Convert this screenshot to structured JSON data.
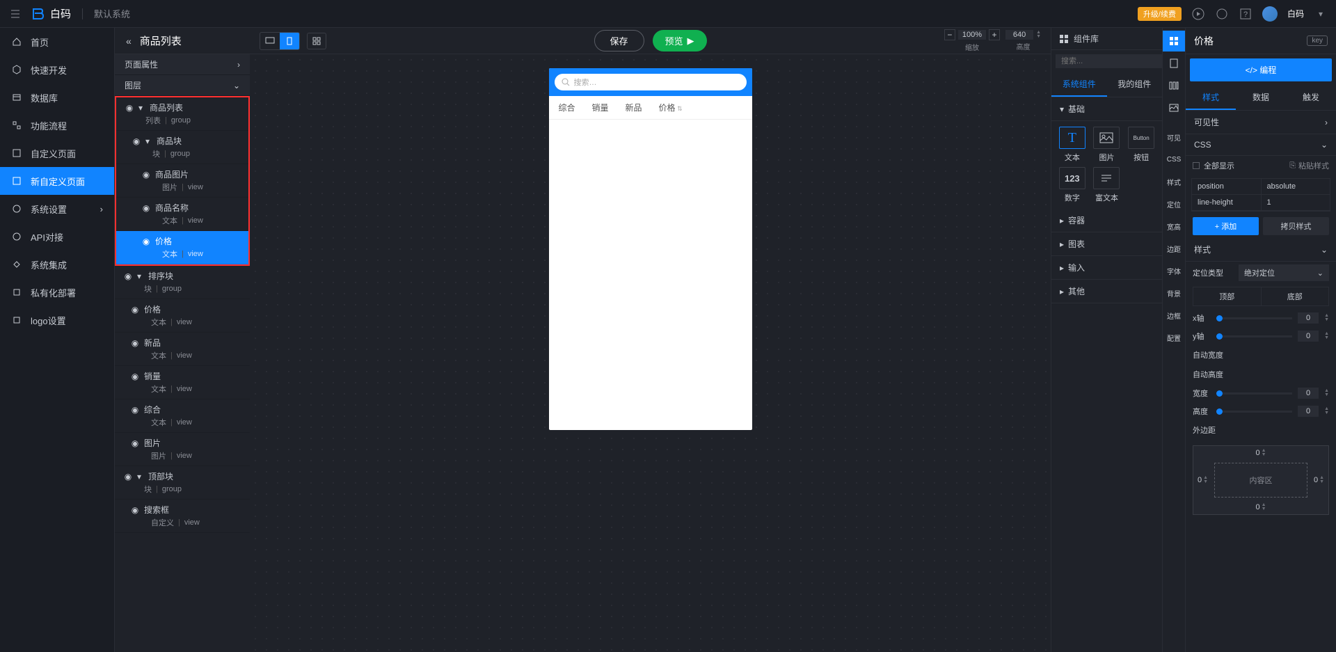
{
  "header": {
    "logo_text": "白码",
    "system_name": "默认系统",
    "upgrade": "升级/续费",
    "username": "白码"
  },
  "nav": {
    "items": [
      {
        "label": "首页"
      },
      {
        "label": "快速开发"
      },
      {
        "label": "数据库"
      },
      {
        "label": "功能流程"
      },
      {
        "label": "自定义页面"
      },
      {
        "label": "新自定义页面"
      },
      {
        "label": "系统设置"
      },
      {
        "label": "API对接"
      },
      {
        "label": "系统集成"
      },
      {
        "label": "私有化部署"
      },
      {
        "label": "logo设置"
      }
    ]
  },
  "layers": {
    "title": "商品列表",
    "panel_props": "页面属性",
    "panel_layers": "图层",
    "tree": [
      {
        "name": "商品列表",
        "type": "列表",
        "sub": "group",
        "indent": 0,
        "expanded": true
      },
      {
        "name": "商品块",
        "type": "块",
        "sub": "group",
        "indent": 1,
        "expanded": true
      },
      {
        "name": "商品图片",
        "type": "图片",
        "sub": "view",
        "indent": 2
      },
      {
        "name": "商品名称",
        "type": "文本",
        "sub": "view",
        "indent": 2
      },
      {
        "name": "价格",
        "type": "文本",
        "sub": "view",
        "indent": 2,
        "active": true
      },
      {
        "name": "排序块",
        "type": "块",
        "sub": "group",
        "indent": 0,
        "expanded": true
      },
      {
        "name": "价格",
        "type": "文本",
        "sub": "view",
        "indent": 1
      },
      {
        "name": "新品",
        "type": "文本",
        "sub": "view",
        "indent": 1
      },
      {
        "name": "销量",
        "type": "文本",
        "sub": "view",
        "indent": 1
      },
      {
        "name": "综合",
        "type": "文本",
        "sub": "view",
        "indent": 1
      },
      {
        "name": "图片",
        "type": "图片",
        "sub": "view",
        "indent": 1
      },
      {
        "name": "顶部块",
        "type": "块",
        "sub": "group",
        "indent": 0,
        "expanded": true
      },
      {
        "name": "搜索框",
        "type": "自定义",
        "sub": "view",
        "indent": 1
      }
    ]
  },
  "toolbar": {
    "save": "保存",
    "preview": "预览",
    "zoom_value": "100%",
    "zoom_label": "缩放",
    "width_value": "640",
    "width_label": "高度"
  },
  "device": {
    "search_placeholder": "搜索…",
    "tabs": [
      "综合",
      "销量",
      "新品",
      "价格"
    ]
  },
  "complib": {
    "title": "组件库",
    "search_placeholder": "搜索...",
    "tab_system": "系统组件",
    "tab_mine": "我的组件",
    "section_basic": "基础",
    "items": [
      {
        "label": "文本",
        "icon": "T"
      },
      {
        "label": "图片",
        "icon": "img"
      },
      {
        "label": "按钮",
        "icon": "Button"
      },
      {
        "label": "数字",
        "icon": "123"
      },
      {
        "label": "富文本",
        "icon": "rt"
      }
    ],
    "section_container": "容器",
    "section_chart": "图表",
    "section_input": "输入",
    "section_other": "其他"
  },
  "strip": {
    "items": [
      "grid",
      "doc",
      "cols",
      "img",
      "可见",
      "CSS",
      "样式",
      "定位",
      "宽高",
      "边距",
      "字体",
      "背景",
      "边框",
      "配置"
    ]
  },
  "props": {
    "title": "价格",
    "key_label": "key",
    "code_btn": "</> 编程",
    "tabs": [
      "样式",
      "数据",
      "触发"
    ],
    "visibility": "可见性",
    "css": "CSS",
    "show_all": "全部显示",
    "paste_style": "粘贴样式",
    "css_rows": [
      {
        "prop": "position",
        "val": "absolute"
      },
      {
        "prop": "line-height",
        "val": "1"
      }
    ],
    "add_btn": "+ 添加",
    "copy_btn": "拷贝样式",
    "style_section": "样式",
    "position_type_label": "定位类型",
    "position_type_value": "绝对定位",
    "top": "顶部",
    "bottom": "底部",
    "x_axis": "x轴",
    "y_axis": "y轴",
    "x_val": "0",
    "y_val": "0",
    "auto_width": "自动宽度",
    "auto_height": "自动高度",
    "width_label": "宽度",
    "height_label": "高度",
    "width_val": "0",
    "height_val": "0",
    "margin_label": "外边距",
    "margin_vals": {
      "top": "0",
      "right": "0",
      "bottom": "0",
      "left": "0"
    },
    "content_area": "内容区"
  }
}
